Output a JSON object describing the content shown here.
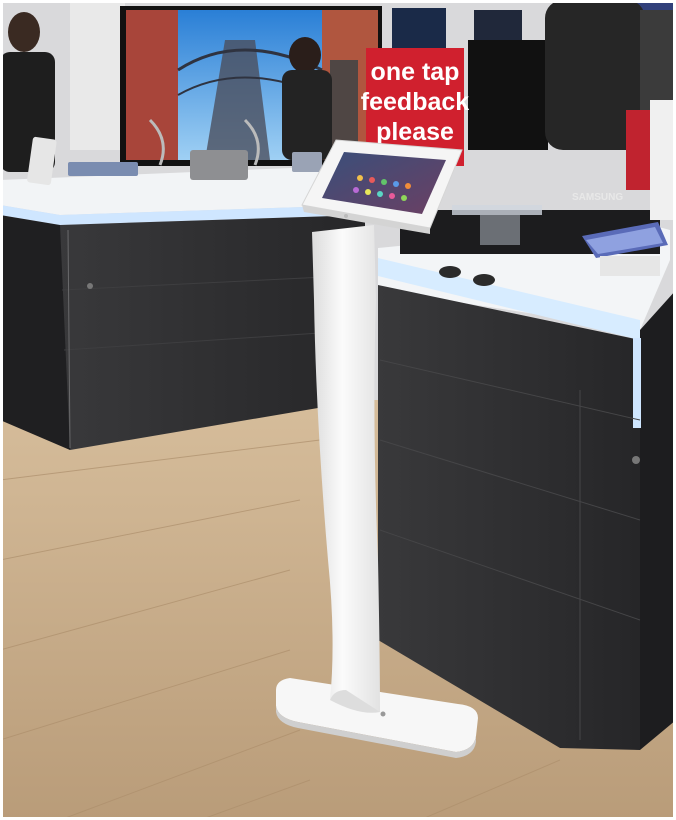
{
  "photo": {
    "sign": {
      "lines": [
        "one tap",
        "feedback",
        "please"
      ],
      "color": "#d0202e"
    },
    "brand_label": "SAMSUNG",
    "colors": {
      "floor": "#c9ae8c",
      "counter": "#2b2b2d",
      "counter_top": "#f4f6f8",
      "stand": "#f2f2f2",
      "led": "#cfe6ff"
    }
  }
}
